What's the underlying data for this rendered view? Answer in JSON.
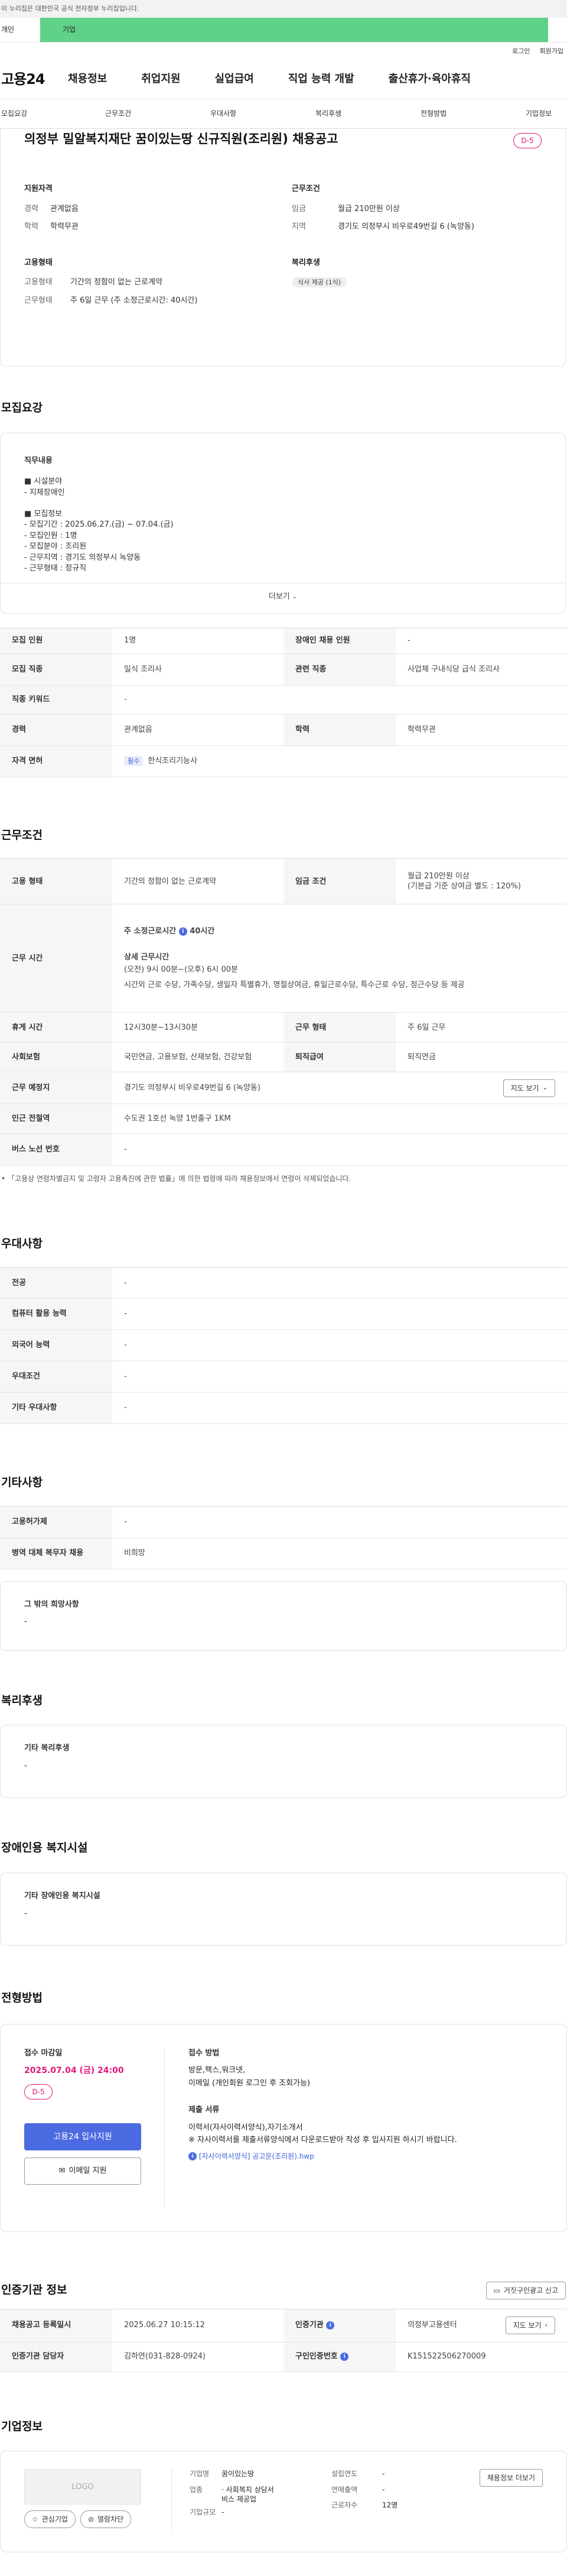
{
  "gov_banner": "이 누리집은 대한민국 공식 전자정부 누리집입니다.",
  "top_tabs": [
    {
      "label": "개인"
    },
    {
      "label": "기업"
    }
  ],
  "util": {
    "login": "로그인",
    "join": "회원가입"
  },
  "logo": "고용24",
  "gnb": [
    "채용정보",
    "취업지원",
    "실업급여",
    "직업 능력 개발",
    "출산휴가·육아휴직"
  ],
  "snb": [
    "모집요강",
    "근무조건",
    "우대사항",
    "복리후생",
    "전형방법",
    "기업정보"
  ],
  "job": {
    "title": "의정부 밀알복지재단 꿈이있는땅 신규직원(조리원) 채용공고",
    "dday": "D-5",
    "summary": {
      "qual": {
        "head": "지원자격",
        "career_k": "경력",
        "career_v": "관계없음",
        "edu_k": "학력",
        "edu_v": "학력무관"
      },
      "cond": {
        "head": "근무조건",
        "pay_k": "임금",
        "pay_v": "월급 210만원 이상",
        "loc_k": "지역",
        "loc_v": "경기도 의정부시 비우로49번길 6 (녹양동)"
      },
      "emp": {
        "head": "고용형태",
        "type_k": "고용형태",
        "type_v": "기간의 정함이 없는 근로계약",
        "form_k": "근무형태",
        "form_v": "주 6일 근무 (주 소정근로시간: 40시간)"
      },
      "welfare": {
        "head": "복리후생",
        "tag": "식사 제공 (1식)"
      }
    }
  },
  "recruit": {
    "title": "모집요강",
    "desc_head": "직무내용",
    "desc_lines": [
      "■ 시설분야",
      "- 지체장애인",
      "",
      "■ 모집정보",
      "- 모집기간 : 2025.06.27.(금) ~ 07.04.(금)",
      "- 모집인원 : 1명",
      "- 모집분야 : 조리원",
      "- 근무지역 : 경기도 의정부시 녹양동",
      "- 근무형태 : 정규직"
    ],
    "more": "더보기",
    "rows": {
      "count_k": "모집 인원",
      "count_v": "1명",
      "dis_k": "장애인 채용 인원",
      "dis_v": "-",
      "job_k": "모집 직종",
      "job_v": "일식 조리사",
      "rel_k": "관련 직종",
      "rel_v": "사업체 구내식당 급식 조리사",
      "kw_k": "직종 키워드",
      "kw_v": "-",
      "car_k": "경력",
      "car_v": "관계없음",
      "edu_k": "학력",
      "edu_v": "학력무관",
      "lic_k": "자격 면허",
      "lic_badge": "필수",
      "lic_v": "한식조리기능사"
    }
  },
  "work": {
    "title": "근무조건",
    "emp_k": "고용 형태",
    "emp_v": "기간의 정함이 없는 근로계약",
    "pay_k": "임금 조건",
    "pay_v1": "월급 210만원 이상",
    "pay_v2": "(기본급 기준 상여금 별도 : 120%)",
    "time_k": "근무 시간",
    "time_week_label": "주 소정근로시간",
    "time_week_v": "40시간",
    "time_detail_head": "상세 근무시간",
    "time_detail": "(오전) 9시 00분~(오후) 6시 00분",
    "time_etc": "시간외 근로 수당, 가족수당, 생일자 특별휴가, 명절상여금, 휴일근로수당, 특수근로 수당, 정근수당 등 제공",
    "rest_k": "휴게 시간",
    "rest_v": "12시30분~13시30분",
    "form_k": "근무 형태",
    "form_v": "주 6일 근무",
    "ins_k": "사회보험",
    "ins_v": "국민연금, 고용보험, 산재보험, 건강보험",
    "ret_k": "퇴직급여",
    "ret_v": "퇴직연금",
    "loc_k": "근무 예정지",
    "loc_v": "경기도 의정부시 비우로49번길 6 (녹양동)",
    "map_btn": "지도 보기",
    "subway_k": "인근 전철역",
    "subway_v": "수도권 1호선 녹양 1번출구 1KM",
    "bus_k": "버스 노선 번호",
    "bus_v": "-",
    "note": "「고용상 연령차별금지 및 고령자 고용촉진에 관한 법률」에 의한 법령에 따라 채용정보에서 연령이 삭제되었습니다."
  },
  "prefer": {
    "title": "우대사항",
    "rows": [
      {
        "k": "전공",
        "v": "-"
      },
      {
        "k": "컴퓨터 활용 능력",
        "v": "-"
      },
      {
        "k": "외국어 능력",
        "v": "-"
      },
      {
        "k": "우대조건",
        "v": "-"
      },
      {
        "k": "기타 우대사항",
        "v": "-"
      }
    ]
  },
  "etc": {
    "title": "기타사항",
    "rows": [
      {
        "k": "고용허가제",
        "v": "-"
      },
      {
        "k": "병역 대체 복무자 채용",
        "v": "비희망"
      }
    ],
    "box_head": "그 밖의 희망사항",
    "box_v": "-"
  },
  "welfare": {
    "title": "복리후생",
    "box_head": "기타 복리후생",
    "box_v": "-"
  },
  "disab": {
    "title": "장애인용 복지시설",
    "box_head": "기타 장애인용 복지시설",
    "box_v": "-"
  },
  "process": {
    "title": "전형방법",
    "deadline_head": "접수 마감일",
    "deadline": "2025.07.04 (금) 24:00",
    "dday": "D-5",
    "apply_btn": "고용24 입사지원",
    "email_btn": "이메일 지원",
    "method_head": "접수 방법",
    "method_v1": "방문,팩스,워크넷,",
    "method_v2": "이메일 (개인회원 로그인 후 조회가능)",
    "docs_head": "제출 서류",
    "docs_v1": "이력서(자사이력서양식),자기소개서",
    "docs_v2": "※ 자사이력서를 제출서류양식에서 다운로드받아 작성 후 입사지원 하시기 바랍니다.",
    "docs_file": "[자사이력서양식] 공고문(조리원).hwp"
  },
  "cert": {
    "title": "인증기관 정보",
    "report_btn": "거짓구인광고 신고",
    "reg_k": "채용공고 등록일시",
    "reg_v": "2025.06.27 10:15:12",
    "org_k": "인증기관",
    "org_v": "의정부고용센터",
    "map_btn": "지도 보기",
    "mgr_k": "인증기관 담당자",
    "mgr_v": "김하연(031-828-0924)",
    "num_k": "구인인증번호",
    "num_v": "K151522506270009"
  },
  "company": {
    "title": "기업정보",
    "logo_ph": "LOGO",
    "fav_btn": "관심기업",
    "block_btn": "열람차단",
    "name_k": "기업명",
    "name_v": "꿈이있는땅",
    "ind_k": "업종",
    "ind_v1": "· 사회복지 상담서",
    "ind_v2": "비스 제공업",
    "size_k": "기업규모",
    "size_v": "-",
    "est_k": "설립연도",
    "est_v": "-",
    "sales_k": "연매출액",
    "sales_v": "-",
    "emp_k": "근로자수",
    "emp_v": "12명",
    "more_btn": "채용정보 더보기"
  }
}
